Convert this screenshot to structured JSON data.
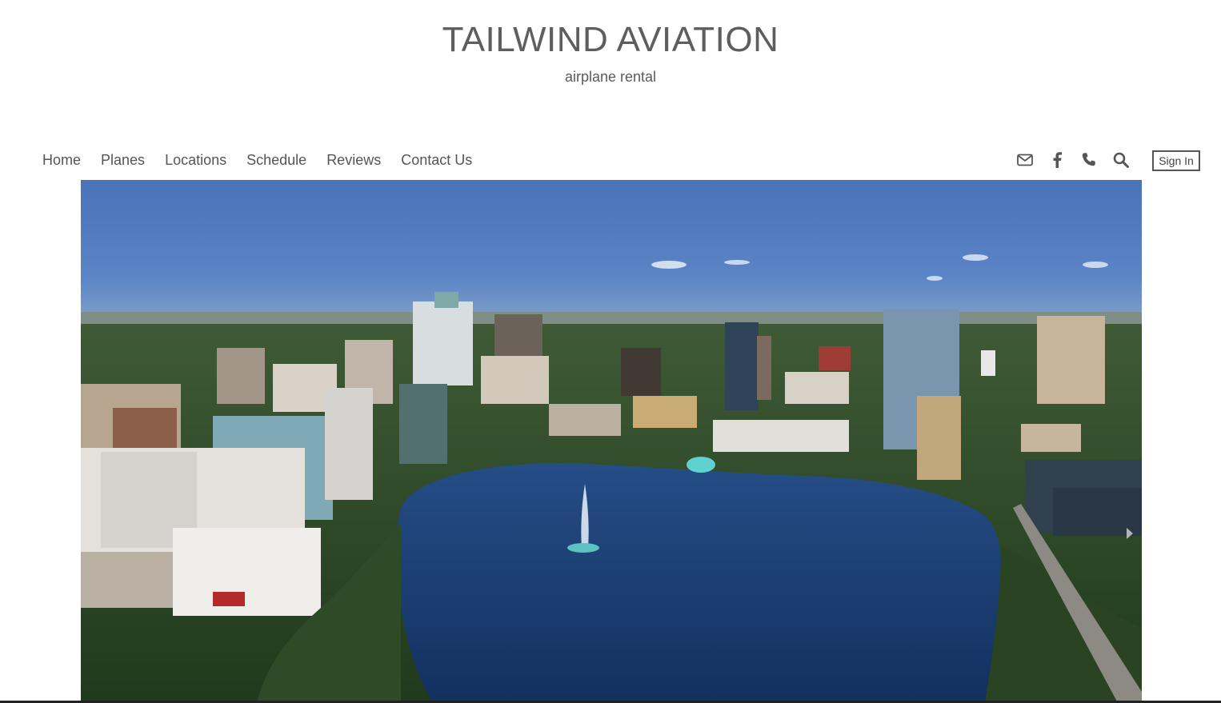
{
  "header": {
    "title": "TAILWIND AVIATION",
    "subtitle": "airplane rental"
  },
  "nav": {
    "links": [
      "Home",
      "Planes",
      "Locations",
      "Schedule",
      "Reviews",
      "Contact Us"
    ],
    "icons": [
      "mail-icon",
      "facebook-icon",
      "phone-icon",
      "search-icon"
    ],
    "sign_in_label": "Sign In"
  },
  "hero": {
    "image": "aerial-city-lake-fountain",
    "next_icon": "chevron-right-icon"
  },
  "colors": {
    "text": "#5f5f5f",
    "sky": "#4f79bd",
    "water": "#1c3f75"
  }
}
